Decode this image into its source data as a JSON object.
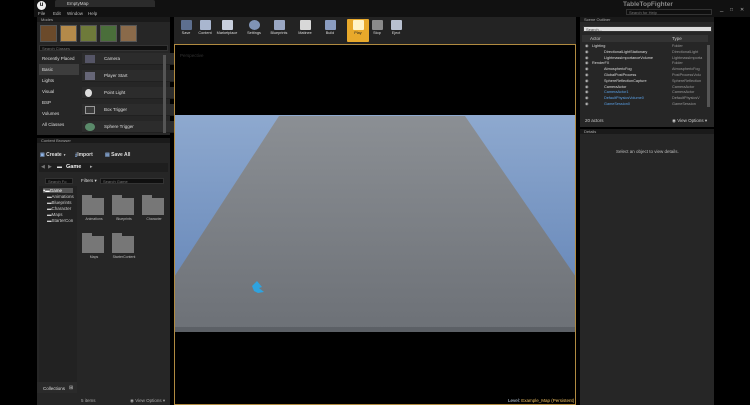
{
  "window": {
    "tab_title": "EmptyMap",
    "project_name": "TableTopFighter",
    "search_help": "Search for Help",
    "win_controls": [
      "_",
      "□",
      "✕"
    ]
  },
  "menu": [
    "File",
    "Edit",
    "Window",
    "Help"
  ],
  "modes": {
    "header": "Modes",
    "search_placeholder": "Search Classes",
    "categories": [
      "Recently Placed",
      "Basic",
      "Lights",
      "Visual",
      "BSP",
      "Volumes",
      "All Classes"
    ],
    "selected_category": 1,
    "items": [
      "Camera",
      "Player Start",
      "Point Light",
      "Box Trigger",
      "Sphere Trigger"
    ]
  },
  "content_browser": {
    "header": "Content Browser",
    "create": "Create",
    "import": "Import",
    "save_all": "Save All",
    "path": "Game",
    "search_folders": "Search Fo",
    "tree": [
      "Game",
      "Animations",
      "Blueprints",
      "Character",
      "Maps",
      "StarterCon"
    ],
    "filters": "Filters",
    "search_assets": "Search Game",
    "assets": [
      "Animations",
      "Blueprints",
      "Character",
      "Maps",
      "StarterContent"
    ],
    "collections": "Collections",
    "item_count": "5 items",
    "view_options": "View Options"
  },
  "toolbar": [
    "Save",
    "Content",
    "Marketplace",
    "Settings",
    "Blueprints",
    "Matinee",
    "Build",
    "Play",
    "Stop",
    "Eject"
  ],
  "viewport": {
    "level_label": "Level:",
    "level_name": "Example_Map (Persistent)",
    "corner_label": "Perspective"
  },
  "outliner": {
    "header": "Scene Outliner",
    "search_placeholder": "Search...",
    "col_actor": "Actor",
    "col_type": "Type",
    "rows": [
      {
        "name": "Lighting",
        "type": "Folder",
        "color": "#dddddd"
      },
      {
        "name": "DirectionalLightStationary",
        "type": "DirectionalLight",
        "color": "#dddddd"
      },
      {
        "name": "LightmassImportanceVolume",
        "type": "LightmassImporta",
        "color": "#dddddd"
      },
      {
        "name": "RenderFX",
        "type": "Folder",
        "color": "#dddddd"
      },
      {
        "name": "AtmosphericFog",
        "type": "AtmosphericFog",
        "color": "#dddddd"
      },
      {
        "name": "GlobalPostProcess",
        "type": "PostProcessVolu",
        "color": "#dddddd"
      },
      {
        "name": "SphereReflectionCapture",
        "type": "SphereReflection",
        "color": "#dddddd"
      },
      {
        "name": "CameraActor",
        "type": "CameraActor",
        "color": "#dddddd"
      },
      {
        "name": "CameraActor1",
        "type": "CameraActor",
        "color": "#5aa0e6"
      },
      {
        "name": "DefaultPhysicsVolume0",
        "type": "DefaultPhysicsV",
        "color": "#5aa0e6"
      },
      {
        "name": "GameSession0",
        "type": "GameSession",
        "color": "#5aa0e6"
      }
    ],
    "actor_count": "20 actors",
    "view_options": "View Options"
  },
  "details": {
    "header": "Details",
    "empty_text": "Select an object to view details."
  },
  "colors": {
    "panel": "#262626",
    "accent": "#e8a92b",
    "selected_actor": "#5aa0e6",
    "sky": "#7e9fc9",
    "floor": "#8e9298"
  }
}
